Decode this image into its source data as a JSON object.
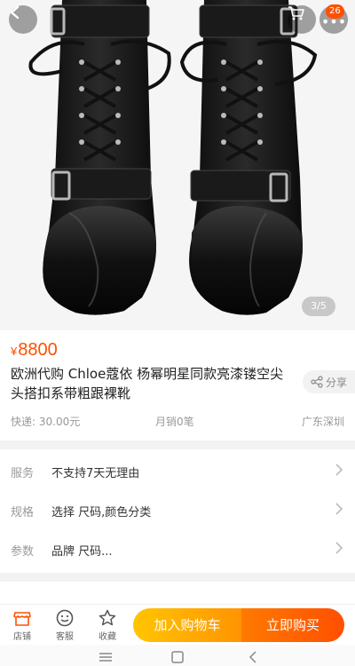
{
  "gallery": {
    "pager": "3/5",
    "cart_badge": "26",
    "image_alt": "black leather lace-up buckle ankle boots"
  },
  "product": {
    "currency": "¥",
    "price": "8800",
    "title": "欧洲代购  Chloe蔻依  杨幂明星同款亮漆镂空尖头搭扣系带粗跟裸靴",
    "share_label": "分享",
    "shipping": "快递: 30.00元",
    "monthly_sales": "月销0笔",
    "location": "广东深圳"
  },
  "info": {
    "service_key": "服务",
    "service_val": "不支持7天无理由",
    "spec_key": "规格",
    "spec_val": "选择 尺码,颜色分类",
    "param_key": "参数",
    "param_val": "品牌 尺码..."
  },
  "bottom_bar": {
    "shop": "店铺",
    "service": "客服",
    "favorite": "收藏",
    "add_cart": "加入购物车",
    "buy_now": "立即购买"
  },
  "colors": {
    "accent": "#ff5000",
    "cart_gradient": [
      "#ffc500",
      "#ff9402"
    ],
    "buy_gradient": [
      "#ff7a00",
      "#ff4f00"
    ]
  }
}
